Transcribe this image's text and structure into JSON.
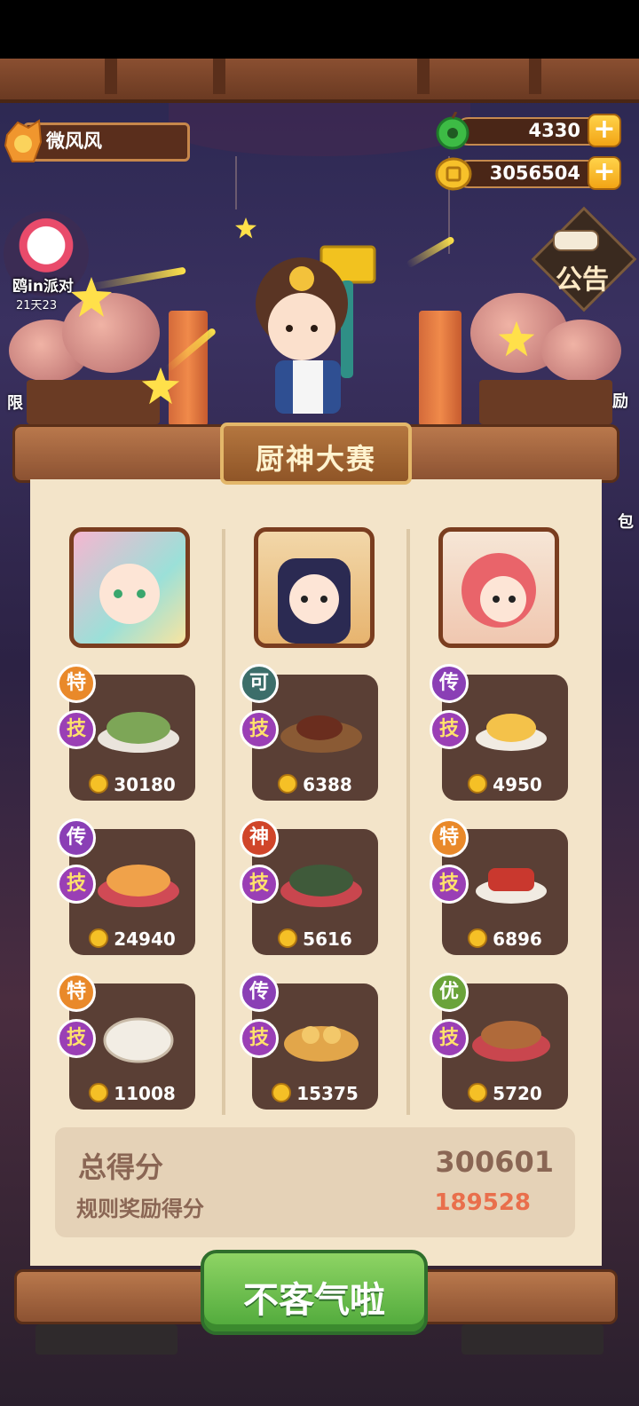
{
  "player": {
    "name": "微风风"
  },
  "currency": {
    "jade": {
      "value": "4330",
      "plus": "+"
    },
    "coins": {
      "value": "3056504",
      "plus": "+"
    }
  },
  "side": {
    "event_label": "鸥in派对",
    "event_time": "21天23",
    "notice_label": "公告",
    "left_cut": "限",
    "right_cut1": "励",
    "right_cut2": "包"
  },
  "panel": {
    "title": "厨神大赛",
    "chefs": [
      {
        "dishes": [
          {
            "rarity": "特",
            "rarity_color": "#e9892a",
            "skill": "技",
            "score": "30180"
          },
          {
            "rarity": "传",
            "rarity_color": "#8a3fb5",
            "skill": "技",
            "score": "24940"
          },
          {
            "rarity": "特",
            "rarity_color": "#e9892a",
            "skill": "技",
            "score": "11008"
          }
        ]
      },
      {
        "dishes": [
          {
            "rarity": "可",
            "rarity_color": "#3c6e6a",
            "skill": "技",
            "score": "6388"
          },
          {
            "rarity": "神",
            "rarity_color": "#d0452a",
            "skill": "技",
            "score": "5616"
          },
          {
            "rarity": "传",
            "rarity_color": "#8a3fb5",
            "skill": "技",
            "score": "15375"
          }
        ]
      },
      {
        "dishes": [
          {
            "rarity": "传",
            "rarity_color": "#8a3fb5",
            "skill": "技",
            "score": "4950"
          },
          {
            "rarity": "特",
            "rarity_color": "#e9892a",
            "skill": "技",
            "score": "6896"
          },
          {
            "rarity": "优",
            "rarity_color": "#6aa33a",
            "skill": "技",
            "score": "5720"
          }
        ]
      }
    ],
    "summary": {
      "total_label": "总得分",
      "total_value": "300601",
      "bonus_label": "规则奖励得分",
      "bonus_value": "189528"
    },
    "confirm_label": "不客气啦"
  }
}
